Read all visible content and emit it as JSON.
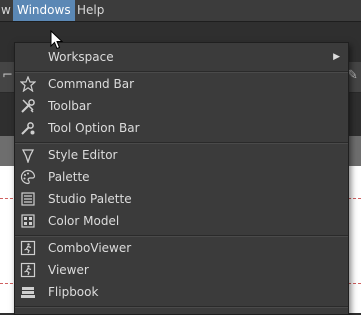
{
  "menubar": {
    "items": [
      {
        "label": "w",
        "active": false
      },
      {
        "label": "Windows",
        "active": true
      },
      {
        "label": "Help",
        "active": false
      }
    ]
  },
  "windows_menu": {
    "items": [
      {
        "label": "Workspace",
        "icon": "none",
        "submenu": true,
        "submenu_glyph": "▶"
      },
      {
        "label": "Command Bar",
        "icon": "star-icon"
      },
      {
        "label": "Toolbar",
        "icon": "tools-icon"
      },
      {
        "label": "Tool Option Bar",
        "icon": "tool-options-icon"
      },
      {
        "label": "Style Editor",
        "icon": "style-editor-icon"
      },
      {
        "label": "Palette",
        "icon": "palette-icon"
      },
      {
        "label": "Studio Palette",
        "icon": "studio-palette-icon"
      },
      {
        "label": "Color Model",
        "icon": "color-model-icon"
      },
      {
        "label": "ComboViewer",
        "icon": "combo-viewer-icon"
      },
      {
        "label": "Viewer",
        "icon": "viewer-icon"
      },
      {
        "label": "Flipbook",
        "icon": "flipbook-icon"
      }
    ]
  },
  "colors": {
    "menubar_bg": "#3c3c3c",
    "menu_bg": "#3b3b3b",
    "active_highlight": "#5b88b5",
    "text": "#dcdcdc",
    "canvas_bg": "#ffffff",
    "canvas_guide": "#d06060"
  }
}
